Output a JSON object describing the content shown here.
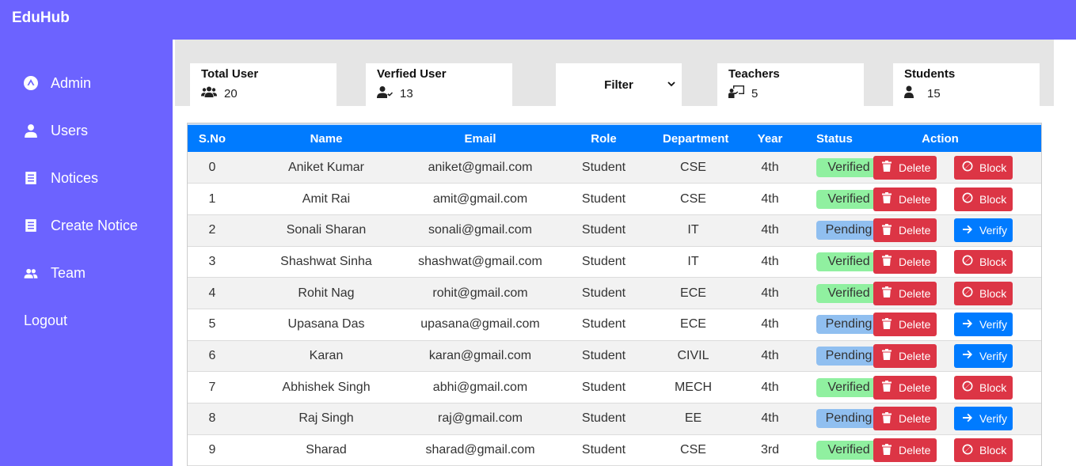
{
  "app": {
    "brand": "EduHub"
  },
  "sidebar": {
    "items": [
      {
        "label": "Admin",
        "icon": "admin-icon"
      },
      {
        "label": "Users",
        "icon": "user-icon"
      },
      {
        "label": "Notices",
        "icon": "notice-icon"
      },
      {
        "label": "Create Notice",
        "icon": "create-notice-icon"
      },
      {
        "label": "Team",
        "icon": "team-icon"
      },
      {
        "label": "Logout",
        "icon": ""
      }
    ]
  },
  "stats": {
    "total_user": {
      "title": "Total User",
      "value": "20",
      "icon": "users-icon"
    },
    "verified_user": {
      "title": "Verfied User",
      "value": "13",
      "icon": "user-check-icon"
    },
    "filter": {
      "label": "Filter"
    },
    "teachers": {
      "title": "Teachers",
      "value": "5",
      "icon": "teacher-icon"
    },
    "students": {
      "title": "Students",
      "value": "15",
      "icon": "student-icon"
    }
  },
  "table": {
    "headers": [
      "S.No",
      "Name",
      "Email",
      "Role",
      "Department",
      "Year",
      "Status",
      "Action"
    ],
    "delete_label": "Delete",
    "block_label": "Block",
    "verify_label": "Verify",
    "rows": [
      {
        "sno": "0",
        "name": "Aniket Kumar",
        "email": "aniket@gmail.com",
        "role": "Student",
        "department": "CSE",
        "year": "4th",
        "status": "Verified",
        "action": "Block"
      },
      {
        "sno": "1",
        "name": "Amit Rai",
        "email": "amit@gmail.com",
        "role": "Student",
        "department": "CSE",
        "year": "4th",
        "status": "Verified",
        "action": "Block"
      },
      {
        "sno": "2",
        "name": "Sonali Sharan",
        "email": "sonali@gmail.com",
        "role": "Student",
        "department": "IT",
        "year": "4th",
        "status": "Pending",
        "action": "Verify"
      },
      {
        "sno": "3",
        "name": "Shashwat Sinha",
        "email": "shashwat@gmail.com",
        "role": "Student",
        "department": "IT",
        "year": "4th",
        "status": "Verified",
        "action": "Block"
      },
      {
        "sno": "4",
        "name": "Rohit Nag",
        "email": "rohit@gmail.com",
        "role": "Student",
        "department": "ECE",
        "year": "4th",
        "status": "Verified",
        "action": "Block"
      },
      {
        "sno": "5",
        "name": "Upasana Das",
        "email": "upasana@gmail.com",
        "role": "Student",
        "department": "ECE",
        "year": "4th",
        "status": "Pending",
        "action": "Verify"
      },
      {
        "sno": "6",
        "name": "Karan",
        "email": "karan@gmail.com",
        "role": "Student",
        "department": "CIVIL",
        "year": "4th",
        "status": "Pending",
        "action": "Verify"
      },
      {
        "sno": "7",
        "name": "Abhishek Singh",
        "email": "abhi@gmail.com",
        "role": "Student",
        "department": "MECH",
        "year": "4th",
        "status": "Verified",
        "action": "Block"
      },
      {
        "sno": "8",
        "name": "Raj Singh",
        "email": "raj@gmail.com",
        "role": "Student",
        "department": "EE",
        "year": "4th",
        "status": "Pending",
        "action": "Verify"
      },
      {
        "sno": "9",
        "name": "Sharad",
        "email": "sharad@gmail.com",
        "role": "Student",
        "department": "CSE",
        "year": "3rd",
        "status": "Verified",
        "action": "Block"
      }
    ]
  },
  "colors": {
    "brand": "#6c63ff",
    "table_header": "#007bff",
    "danger": "#dc3545",
    "primary": "#007bff",
    "verified": "#90f0a0",
    "pending": "#90bff0"
  }
}
